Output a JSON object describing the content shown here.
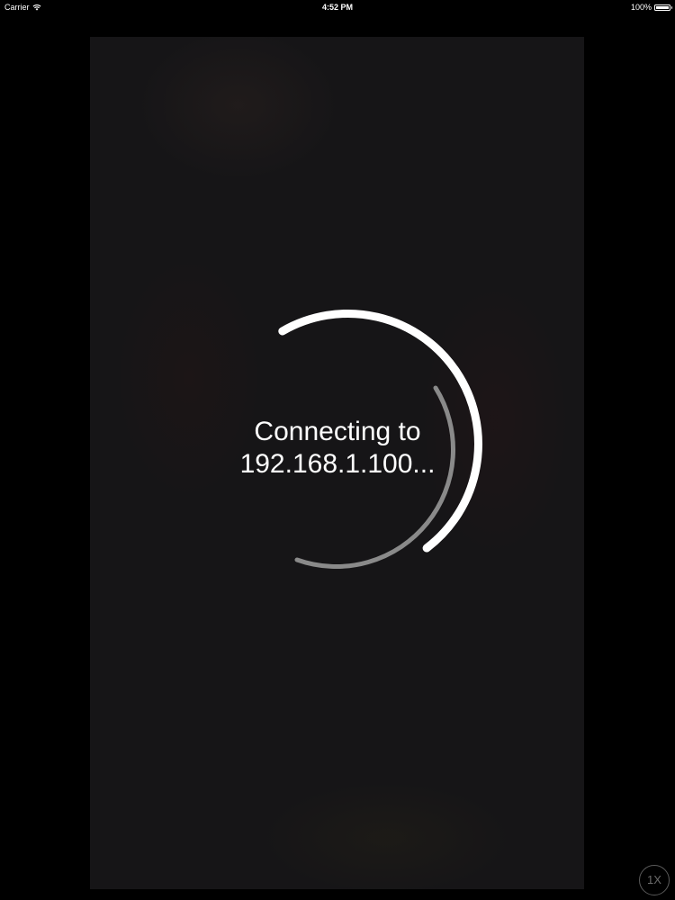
{
  "status_bar": {
    "carrier": "Carrier",
    "wifi_icon": "wifi-icon",
    "time": "4:52 PM",
    "battery_percent": "100%",
    "battery_icon": "battery-icon",
    "battery_level": 1.0
  },
  "connection": {
    "line1": "Connecting to",
    "line2": "192.168.1.100..."
  },
  "spinner": {
    "outer_color": "#ffffff",
    "inner_color": "#8a8a8a"
  },
  "speed_button": {
    "label": "1X"
  },
  "colors": {
    "background": "#000000",
    "video_background": "#161517",
    "text": "#ffffff"
  }
}
